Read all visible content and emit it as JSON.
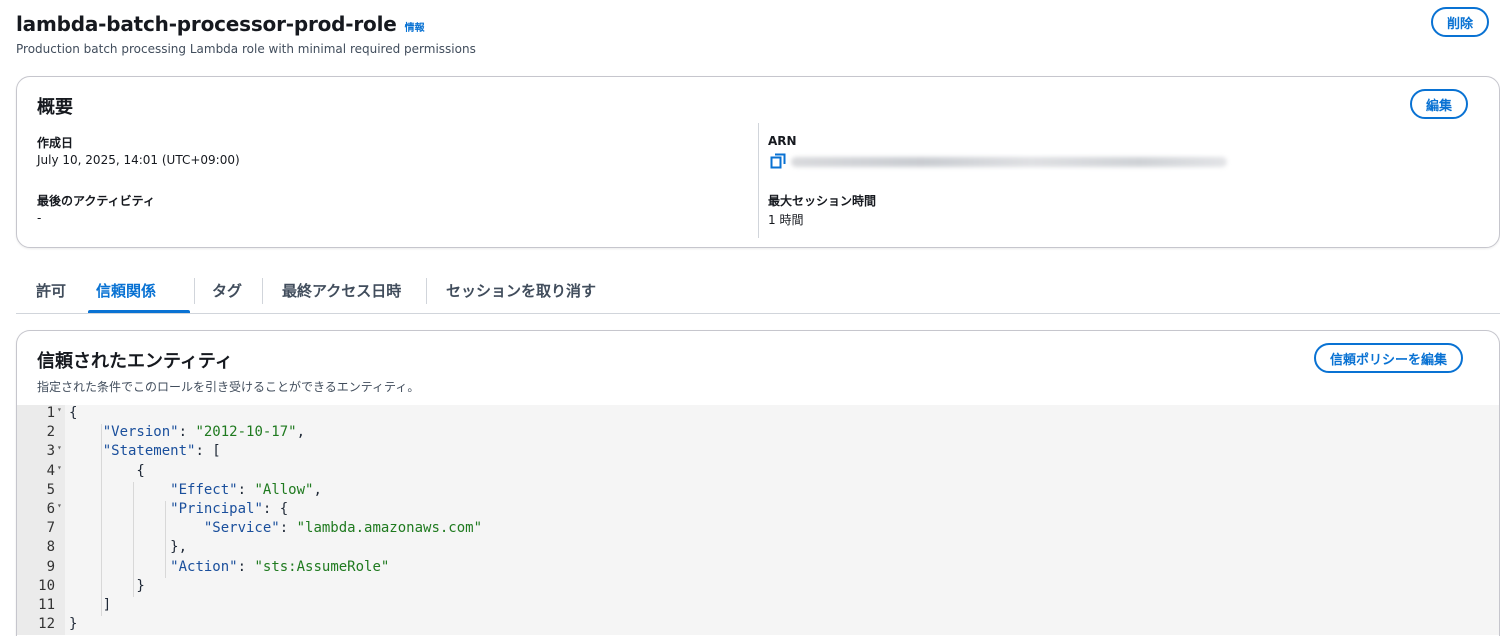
{
  "header": {
    "role_name": "lambda-batch-processor-prod-role",
    "info_label": "情報",
    "description": "Production batch processing Lambda role with minimal required permissions",
    "delete_label": "削除"
  },
  "overview": {
    "title": "概要",
    "edit_label": "編集",
    "created_label": "作成日",
    "created_value": "July 10, 2025, 14:01 (UTC+09:00)",
    "last_activity_label": "最後のアクティビティ",
    "last_activity_value": "-",
    "arn_label": "ARN",
    "max_session_label": "最大セッション時間",
    "max_session_value": "1 時間"
  },
  "tabs": [
    {
      "label": "許可",
      "active": false
    },
    {
      "label": "信頼関係",
      "active": true
    },
    {
      "label": "タグ",
      "active": false
    },
    {
      "label": "最終アクセス日時",
      "active": false
    },
    {
      "label": "セッションを取り消す",
      "active": false
    }
  ],
  "trusted_entities": {
    "title": "信頼されたエンティティ",
    "subtitle": "指定された条件でこのロールを引き受けることができるエンティティ。",
    "edit_policy_label": "信頼ポリシーを編集",
    "code_lines": [
      {
        "n": "1",
        "fold": true,
        "text": "{"
      },
      {
        "n": "2",
        "fold": false,
        "text": "    \"Version\": \"2012-10-17\","
      },
      {
        "n": "3",
        "fold": true,
        "text": "    \"Statement\": ["
      },
      {
        "n": "4",
        "fold": true,
        "text": "        {"
      },
      {
        "n": "5",
        "fold": false,
        "text": "            \"Effect\": \"Allow\","
      },
      {
        "n": "6",
        "fold": true,
        "text": "            \"Principal\": {"
      },
      {
        "n": "7",
        "fold": false,
        "text": "                \"Service\": \"lambda.amazonaws.com\""
      },
      {
        "n": "8",
        "fold": false,
        "text": "            },"
      },
      {
        "n": "9",
        "fold": false,
        "text": "            \"Action\": \"sts:AssumeRole\""
      },
      {
        "n": "10",
        "fold": false,
        "text": "        }"
      },
      {
        "n": "11",
        "fold": false,
        "text": "    ]"
      },
      {
        "n": "12",
        "fold": false,
        "text": "}"
      }
    ]
  },
  "colors": {
    "accent": "#0972d3",
    "json_key": "#1a4f9c",
    "json_string": "#1f7a1f"
  }
}
